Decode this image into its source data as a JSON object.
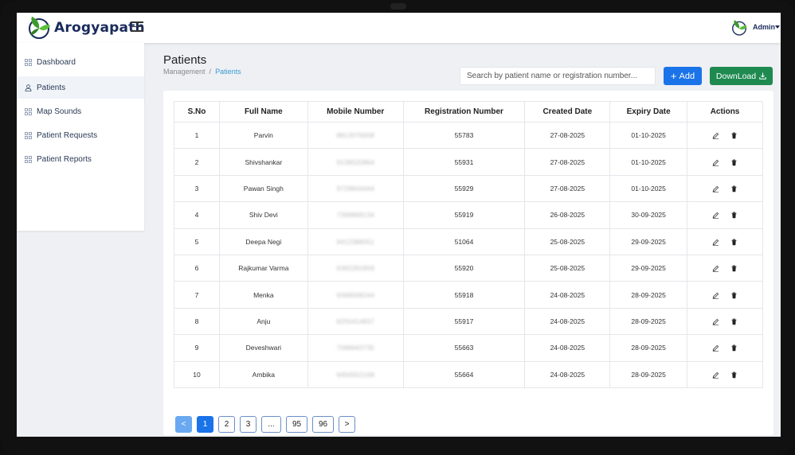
{
  "app": {
    "name": "Arogyapath"
  },
  "header": {
    "admin_label": "Admin"
  },
  "sidebar": {
    "items": [
      {
        "label": "Dashboard",
        "icon": "grid-icon"
      },
      {
        "label": "Patients",
        "icon": "user-icon",
        "active": true
      },
      {
        "label": "Map Sounds",
        "icon": "grid-icon"
      },
      {
        "label": "Patient Requests",
        "icon": "grid-icon"
      },
      {
        "label": "Patient Reports",
        "icon": "grid-icon"
      }
    ]
  },
  "page": {
    "title": "Patients",
    "breadcrumb": {
      "parent": "Management",
      "separator": "/",
      "current": "Patients"
    }
  },
  "toolbar": {
    "search_placeholder": "Search by patient name or registration number...",
    "add_label": "Add",
    "download_label": "DownLoad"
  },
  "table": {
    "columns": [
      "S.No",
      "Full Name",
      "Mobile Number",
      "Registration Number",
      "Created Date",
      "Expiry Date",
      "Actions"
    ],
    "rows": [
      {
        "sno": "1",
        "name": "Parvin",
        "mobile": "8813076908",
        "reg": "55783",
        "created": "27-08-2025",
        "expiry": "01-10-2025"
      },
      {
        "sno": "2",
        "name": "Shivshankar",
        "mobile": "9138520864",
        "reg": "55931",
        "created": "27-08-2025",
        "expiry": "01-10-2025"
      },
      {
        "sno": "3",
        "name": "Pawan Singh",
        "mobile": "9729844444",
        "reg": "55929",
        "created": "27-08-2025",
        "expiry": "01-10-2025"
      },
      {
        "sno": "4",
        "name": "Shiv Devi",
        "mobile": "7398868134",
        "reg": "55919",
        "created": "26-08-2025",
        "expiry": "30-09-2025"
      },
      {
        "sno": "5",
        "name": "Deepa Negi",
        "mobile": "9412388051",
        "reg": "51064",
        "created": "25-08-2025",
        "expiry": "29-09-2025"
      },
      {
        "sno": "6",
        "name": "Rajkumar Varma",
        "mobile": "6392281859",
        "reg": "55920",
        "created": "25-08-2025",
        "expiry": "29-09-2025"
      },
      {
        "sno": "7",
        "name": "Menka",
        "mobile": "9368568244",
        "reg": "55918",
        "created": "24-08-2025",
        "expiry": "28-09-2025"
      },
      {
        "sno": "8",
        "name": "Anju",
        "mobile": "8255414837",
        "reg": "55917",
        "created": "24-08-2025",
        "expiry": "28-09-2025"
      },
      {
        "sno": "9",
        "name": "Deveshwari",
        "mobile": "7088643735",
        "reg": "55663",
        "created": "24-08-2025",
        "expiry": "28-09-2025"
      },
      {
        "sno": "10",
        "name": "Ambika",
        "mobile": "9456552168",
        "reg": "55664",
        "created": "24-08-2025",
        "expiry": "28-09-2025"
      }
    ]
  },
  "pagination": {
    "prev": "<",
    "pages": [
      "1",
      "2",
      "3",
      "...",
      "95",
      "96"
    ],
    "current": "1",
    "next": ">"
  },
  "colors": {
    "brand_text": "#1a2b5c",
    "add_button": "#1a73e8",
    "download_button": "#1e8a50",
    "breadcrumb_active": "#3a9bd5"
  }
}
